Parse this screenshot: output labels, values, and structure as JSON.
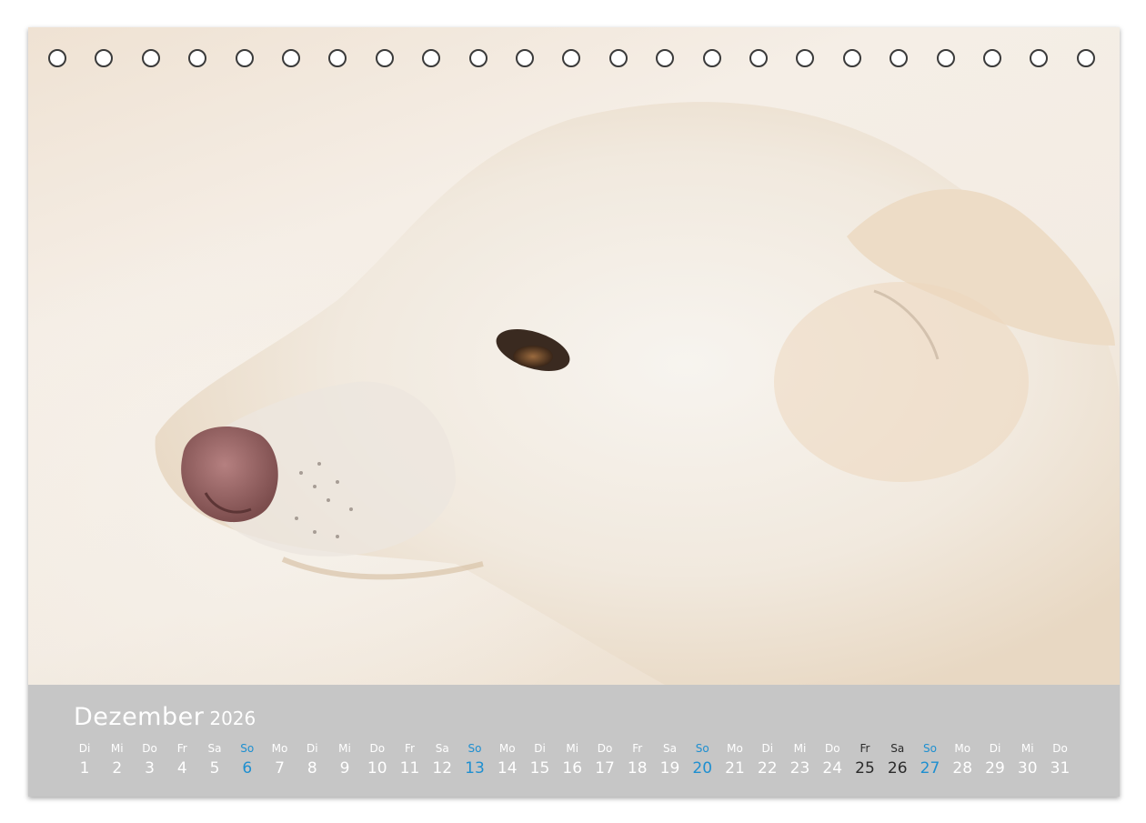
{
  "calendar": {
    "month": "Dezember",
    "year": "2026",
    "days": [
      {
        "weekday": "Di",
        "num": "1",
        "type": "normal"
      },
      {
        "weekday": "Mi",
        "num": "2",
        "type": "normal"
      },
      {
        "weekday": "Do",
        "num": "3",
        "type": "normal"
      },
      {
        "weekday": "Fr",
        "num": "4",
        "type": "normal"
      },
      {
        "weekday": "Sa",
        "num": "5",
        "type": "normal"
      },
      {
        "weekday": "So",
        "num": "6",
        "type": "sunday"
      },
      {
        "weekday": "Mo",
        "num": "7",
        "type": "normal"
      },
      {
        "weekday": "Di",
        "num": "8",
        "type": "normal"
      },
      {
        "weekday": "Mi",
        "num": "9",
        "type": "normal"
      },
      {
        "weekday": "Do",
        "num": "10",
        "type": "normal"
      },
      {
        "weekday": "Fr",
        "num": "11",
        "type": "normal"
      },
      {
        "weekday": "Sa",
        "num": "12",
        "type": "normal"
      },
      {
        "weekday": "So",
        "num": "13",
        "type": "sunday"
      },
      {
        "weekday": "Mo",
        "num": "14",
        "type": "normal"
      },
      {
        "weekday": "Di",
        "num": "15",
        "type": "normal"
      },
      {
        "weekday": "Mi",
        "num": "16",
        "type": "normal"
      },
      {
        "weekday": "Do",
        "num": "17",
        "type": "normal"
      },
      {
        "weekday": "Fr",
        "num": "18",
        "type": "normal"
      },
      {
        "weekday": "Sa",
        "num": "19",
        "type": "normal"
      },
      {
        "weekday": "So",
        "num": "20",
        "type": "sunday"
      },
      {
        "weekday": "Mo",
        "num": "21",
        "type": "normal"
      },
      {
        "weekday": "Di",
        "num": "22",
        "type": "normal"
      },
      {
        "weekday": "Mi",
        "num": "23",
        "type": "normal"
      },
      {
        "weekday": "Do",
        "num": "24",
        "type": "normal"
      },
      {
        "weekday": "Fr",
        "num": "25",
        "type": "holiday"
      },
      {
        "weekday": "Sa",
        "num": "26",
        "type": "holiday"
      },
      {
        "weekday": "So",
        "num": "27",
        "type": "sunday"
      },
      {
        "weekday": "Mo",
        "num": "28",
        "type": "normal"
      },
      {
        "weekday": "Di",
        "num": "29",
        "type": "normal"
      },
      {
        "weekday": "Mi",
        "num": "30",
        "type": "normal"
      },
      {
        "weekday": "Do",
        "num": "31",
        "type": "normal"
      }
    ]
  },
  "colors": {
    "panel": "#c6c6c6",
    "text": "#ffffff",
    "sunday": "#1e8fd0",
    "holiday": "#2b2b2b"
  },
  "photo": {
    "subject": "white-dog-profile"
  },
  "binding": {
    "hole_count": 23
  }
}
